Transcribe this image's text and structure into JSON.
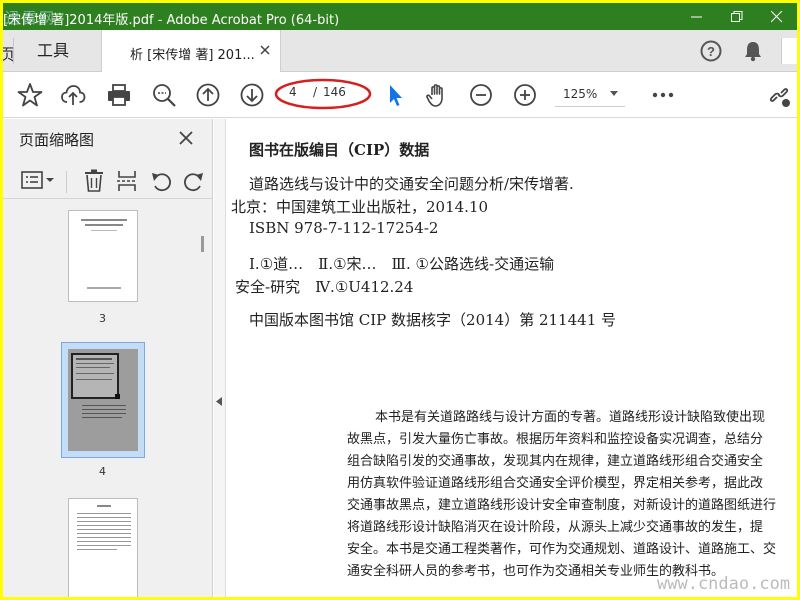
{
  "window": {
    "title": "[宋传增 著]2014年版.pdf - Adobe Acrobat Pro (64-bit)",
    "watermark": "迅雷网"
  },
  "tabs": {
    "home_partial": "页",
    "tools_label": "工具",
    "doc_label": "析 [宋传增 著] 201..."
  },
  "toolbar": {
    "page_current": "4",
    "page_separator": "/",
    "page_total": "146",
    "zoom": "125%"
  },
  "sidepanel": {
    "title": "页面缩略图",
    "thumbnails": [
      {
        "label": "3"
      },
      {
        "label": "4"
      },
      {
        "label": ""
      }
    ]
  },
  "document": {
    "cip_lines": [
      "图书在版编目（CIP）数据",
      "道路选线与设计中的交通安全问题分析/宋传增著.",
      "北京：中国建筑工业出版社，2014.10",
      "ISBN 978-7-112-17254-2",
      "Ⅰ.①道…　Ⅱ.①宋…　Ⅲ. ①公路选线-交通运输",
      "安全-研究　Ⅳ.①U412.24",
      "中国版本图书馆 CIP 数据核字（2014）第 211441 号"
    ],
    "body_lines": [
      "本书是有关道路路线与设计方面的专著。道路线形设计缺陷致使出现",
      "故黑点，引发大量伤亡事故。根据历年资料和监控设备实况调查，总结分",
      "组合缺陷引发的交通事故，发现其内在规律，建立道路线形组合交通安全",
      "用仿真软件验证道路线形组合交通安全评价模型，界定相关参考，据此改",
      "交通事故黑点，建立道路线形设计安全审查制度，对新设计的道路图纸进行",
      "将道路线形设计缺陷消灭在设计阶段，从源头上减少交通事故的发生，提",
      "安全。本书是交通工程类著作，可作为交通规划、道路设计、道路施工、交",
      "通安全科研人员的参考书，也可作为交通相关专业师生的教科书。"
    ],
    "watermark": "www.cndao.com"
  },
  "colors": {
    "titlebar": "#2d7f1f",
    "highlight_ellipse": "#d61f1f",
    "pointer_active": "#1473e6",
    "frame": "#ffff00"
  }
}
